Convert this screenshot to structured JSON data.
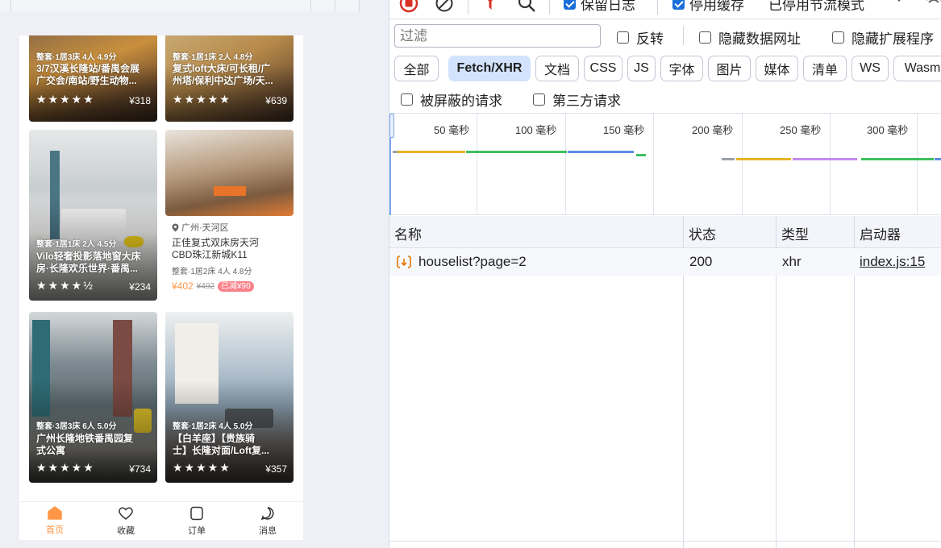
{
  "preview": {
    "cards": [
      {
        "summary": "整套·1居3床 4人 4.9分",
        "title": "3/7汉溪长隆站/番禺会展\n广交会/南站/野生动物...",
        "price": "¥318"
      },
      {
        "summary": "整套·1居1床 2人 4.8分",
        "title": "复式loft大床/可长租/广\n州塔/保利中达广场/天...",
        "price": "¥639"
      },
      {
        "summary": "整套·1居1床 2人 4.5分",
        "title": "Vilo轻奢投影落地窗大床\n房·长隆欢乐世界·番禺...",
        "price": "¥234"
      },
      {
        "location": "广州·天河区",
        "title": "正佳复式双床房天河\nCBD珠江新城K11",
        "summary": "整套·1居2床 4人 4.8分",
        "price_now": "¥402",
        "price_old": "¥492",
        "discount": "已减¥90"
      },
      {
        "summary": "整套·3居3床 6人 5.0分",
        "title": "广州长隆地铁番禺园复\n式公寓",
        "price": "¥734"
      },
      {
        "summary": "整套·1居2床 4人 5.0分",
        "title": "【白羊座】【贵族骑\n士】长隆对面/Loft复...",
        "price": "¥357"
      }
    ],
    "stars": [
      "★★★★★",
      "★★★★★",
      "★★★★½",
      "★★★★★",
      "★★★★★"
    ],
    "tabbar": [
      {
        "label": "首页",
        "active": true
      },
      {
        "label": "收藏"
      },
      {
        "label": "订单"
      },
      {
        "label": "消息"
      }
    ]
  },
  "devtools": {
    "toolbar": {
      "preserve_log": "保留日志",
      "disable_cache": "停用缓存",
      "throttle": "已停用节流模式"
    },
    "filter_placeholder": "过滤",
    "invert": "反转",
    "hide_data_urls": "隐藏数据网址",
    "hide_extension_urls": "隐藏扩展程序",
    "types": [
      "全部",
      "Fetch/XHR",
      "文档",
      "CSS",
      "JS",
      "字体",
      "图片",
      "媒体",
      "清单",
      "WS",
      "Wasm"
    ],
    "active_type": "Fetch/XHR",
    "blocked_requests": "被屏蔽的请求",
    "third_party": "第三方请求",
    "timeline_ticks": [
      "50 毫秒",
      "100 毫秒",
      "150 毫秒",
      "200 毫秒",
      "250 毫秒",
      "300 毫秒"
    ],
    "columns": [
      "名称",
      "状态",
      "类型",
      "启动器"
    ],
    "rows": [
      {
        "name": "houselist?page=2",
        "status": "200",
        "type": "xhr",
        "initiator": "index.js:15"
      }
    ],
    "colors": {
      "active_type_bg": "#d3e3fd",
      "accent": "#1a6ed8",
      "record": "#d93025"
    }
  }
}
